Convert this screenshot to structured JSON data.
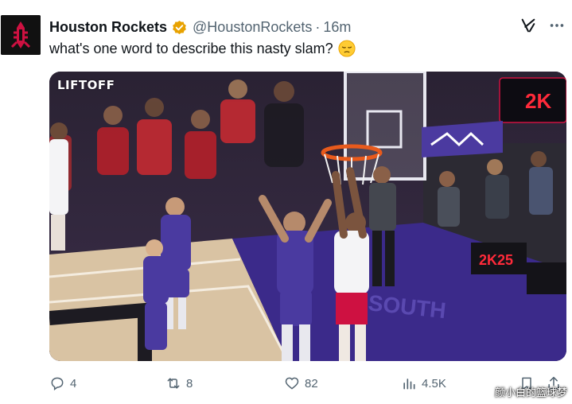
{
  "tweet": {
    "display_name": "Houston Rockets",
    "handle": "@HoustonRockets",
    "separator": "·",
    "time": "16m",
    "text": "what's one word to describe this nasty slam?"
  },
  "media": {
    "watermark": "LIFTOFF",
    "court_text": "SOUTH",
    "board_text": "2K",
    "board_text_2": "2K25"
  },
  "actions": {
    "replies": "4",
    "reposts": "8",
    "likes": "82",
    "views": "4.5K"
  },
  "overlay_watermark": "颜小白的篮球梦",
  "icons": {
    "verified": "verified-badge-icon",
    "grok": "grok-icon",
    "more": "more-icon",
    "reply": "reply-icon",
    "repost": "repost-icon",
    "like": "heart-icon",
    "views": "views-icon",
    "bookmark": "bookmark-icon",
    "share": "share-icon"
  },
  "colors": {
    "verified": "#e8a200",
    "muted": "#536471",
    "rockets_red": "#ce1141",
    "court_purple": "#3b2a8a"
  }
}
